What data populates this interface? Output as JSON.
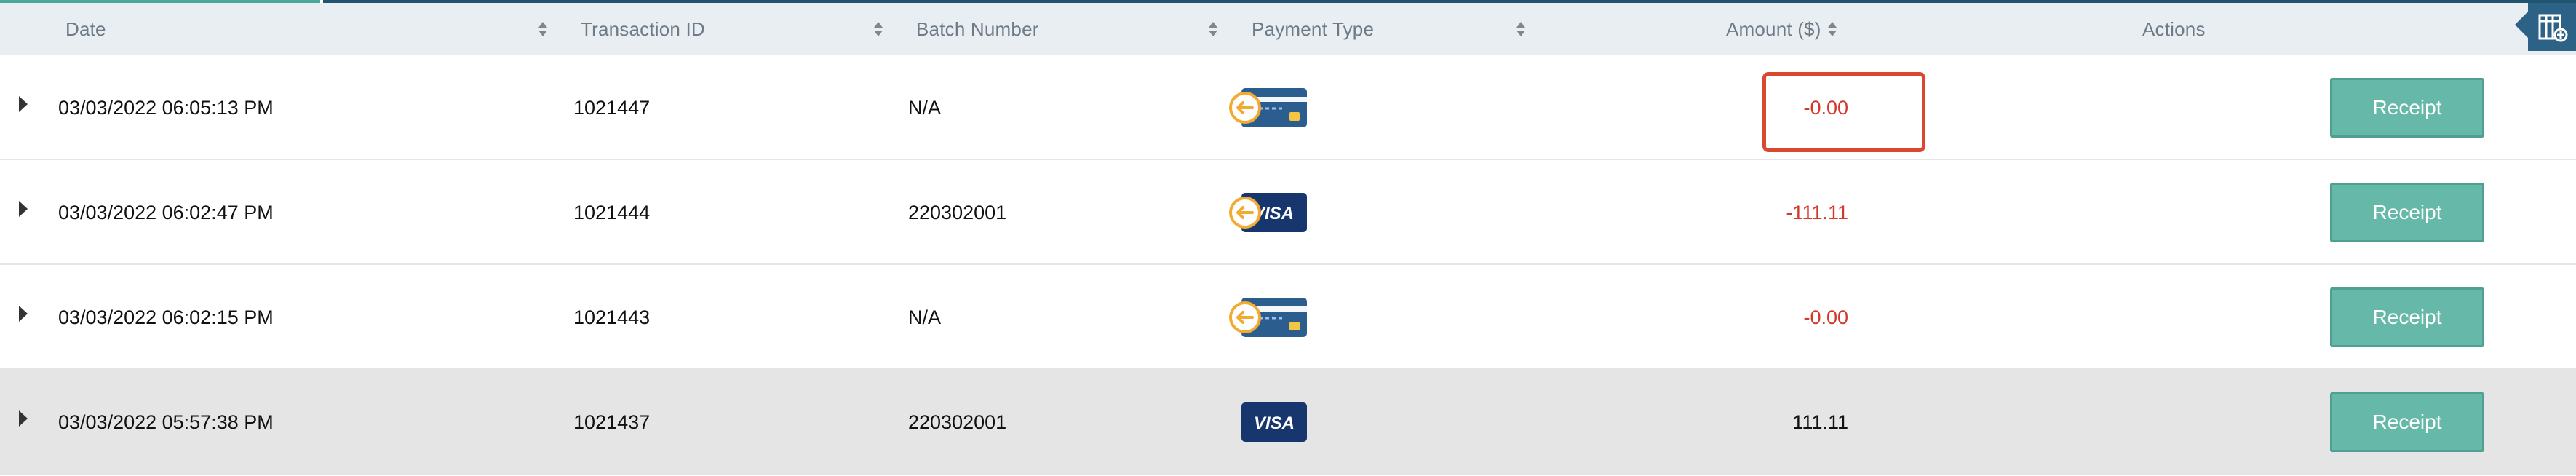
{
  "columns": {
    "date": "Date",
    "transaction_id": "Transaction ID",
    "batch_number": "Batch Number",
    "payment_type": "Payment Type",
    "amount": "Amount ($)",
    "actions": "Actions"
  },
  "toolbar": {
    "column_chooser_icon": "table-settings-icon"
  },
  "rows": [
    {
      "date": "03/03/2022 06:05:13 PM",
      "transaction_id": "1021447",
      "batch_number": "N/A",
      "payment_type_icon": "refund-credit-card-icon",
      "amount": "-0.00",
      "amount_color": "#d2382c",
      "receipt": "Receipt"
    },
    {
      "date": "03/03/2022 06:02:47 PM",
      "transaction_id": "1021444",
      "batch_number": "220302001",
      "payment_type_icon": "refund-visa-card-icon",
      "amount": "-111.11",
      "amount_color": "#d2382c",
      "receipt": "Receipt"
    },
    {
      "date": "03/03/2022 06:02:15 PM",
      "transaction_id": "1021443",
      "batch_number": "N/A",
      "payment_type_icon": "refund-credit-card-icon",
      "amount": "-0.00",
      "amount_color": "#d2382c",
      "receipt": "Receipt"
    },
    {
      "date": "03/03/2022 05:57:38 PM",
      "transaction_id": "1021437",
      "batch_number": "220302001",
      "payment_type_icon": "visa-card-icon",
      "amount": "111.11",
      "amount_color": "#111111",
      "receipt": "Receipt"
    }
  ],
  "colors": {
    "header_background": "#e9eef2",
    "accent_blue": "#2c6286",
    "receipt_button": "#66b8a8",
    "negative_amount": "#d2382c",
    "highlight": "#d9482f",
    "selected_row": "#e5e5e5"
  }
}
